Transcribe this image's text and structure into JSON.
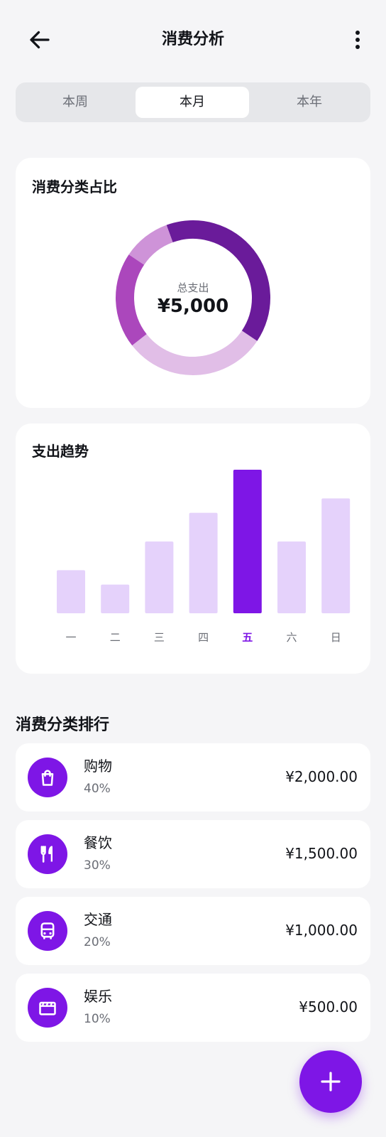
{
  "header": {
    "title": "消费分析",
    "back_icon": "arrow-left-icon",
    "more_icon": "more-vertical-icon"
  },
  "period_tabs": [
    {
      "label": "本周",
      "active": false
    },
    {
      "label": "本月",
      "active": true
    },
    {
      "label": "本年",
      "active": false
    }
  ],
  "category_share": {
    "title": "消费分类占比",
    "center_label": "总支出",
    "center_value": "¥5,000",
    "chart_data": {
      "type": "pie",
      "values": [
        2000,
        1500,
        1000,
        500
      ],
      "percentages": [
        40,
        30,
        20,
        10
      ],
      "colors": [
        "#6a1b9a",
        "#e1bee7",
        "#ab47bc",
        "#ce93d8"
      ]
    }
  },
  "trend": {
    "title": "支出趋势",
    "chart_data": {
      "type": "bar",
      "categories": [
        "一",
        "二",
        "三",
        "四",
        "五",
        "六",
        "日"
      ],
      "values": [
        30,
        20,
        50,
        70,
        100,
        50,
        80
      ],
      "highlight_index": 4,
      "ylim": [
        0,
        100
      ],
      "bar_color": "#e5d2fb",
      "highlight_color": "#7e16e6"
    }
  },
  "ranking": {
    "title": "消费分类排行",
    "items": [
      {
        "name": "购物",
        "percent": "40%",
        "amount": "¥2,000.00",
        "icon": "shopping-bag-icon"
      },
      {
        "name": "餐饮",
        "percent": "30%",
        "amount": "¥1,500.00",
        "icon": "restaurant-icon"
      },
      {
        "name": "交通",
        "percent": "20%",
        "amount": "¥1,000.00",
        "icon": "bus-icon"
      },
      {
        "name": "娱乐",
        "percent": "10%",
        "amount": "¥500.00",
        "icon": "movie-icon"
      }
    ]
  },
  "fab": {
    "icon": "plus-icon"
  },
  "colors": {
    "accent": "#7e16e6",
    "background": "#f5f5f7",
    "card": "#ffffff"
  }
}
